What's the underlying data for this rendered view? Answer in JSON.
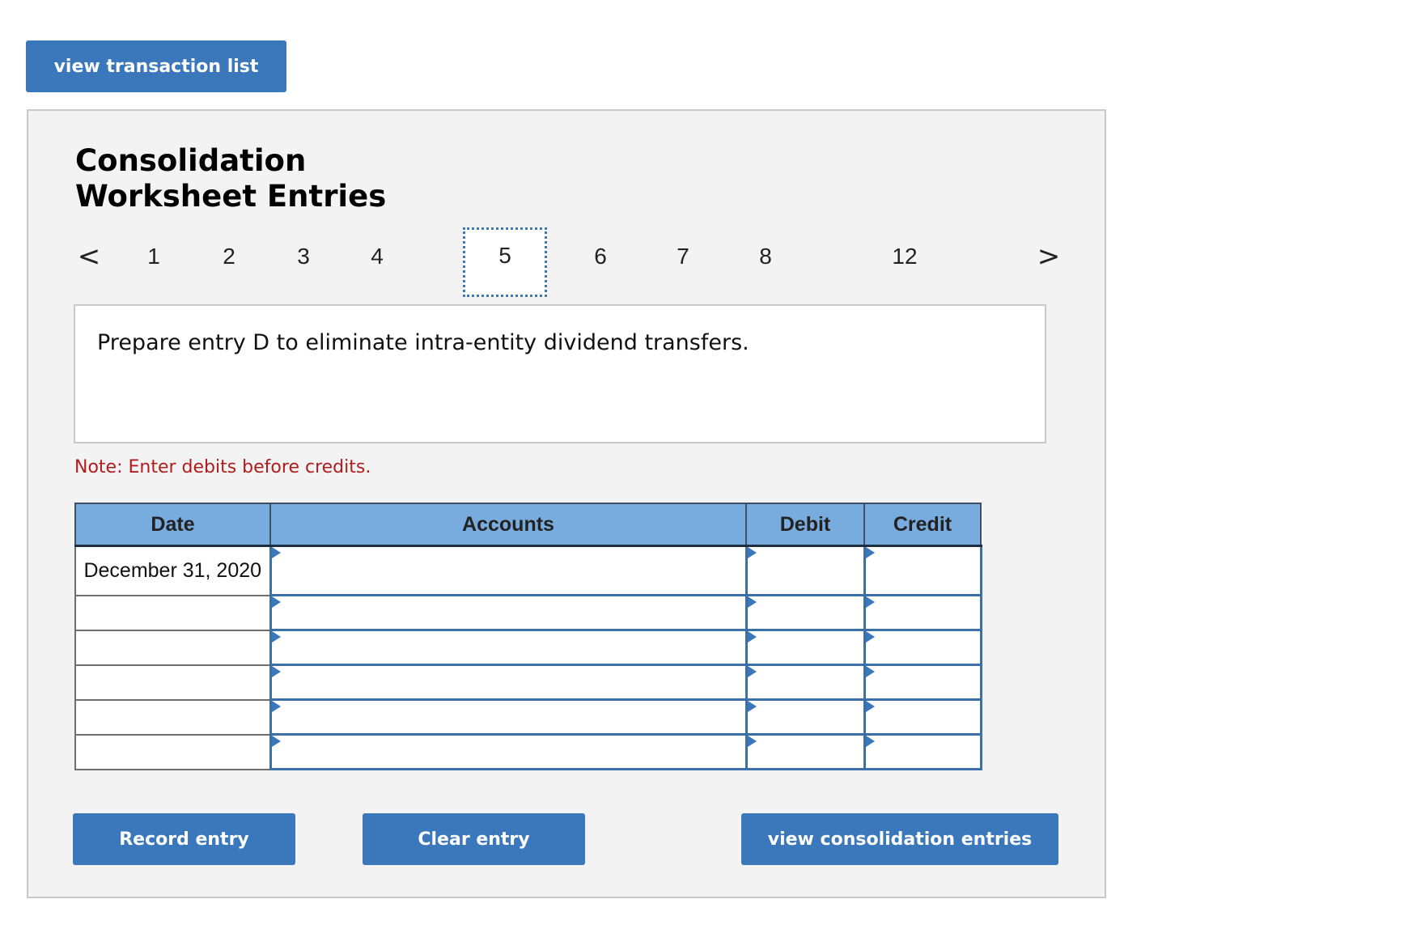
{
  "top_button": {
    "label": "view transaction list"
  },
  "panel": {
    "title_line1": "Consolidation",
    "title_line2": "Worksheet Entries",
    "pager": {
      "prev": "<",
      "next": ">",
      "pages": [
        "1",
        "2",
        "3",
        "4",
        "5",
        "6",
        "7",
        "8",
        "12"
      ],
      "active": "5"
    },
    "instruction": "Prepare entry D to eliminate intra-entity dividend transfers.",
    "note": "Note: Enter debits before credits.",
    "table": {
      "headers": [
        "Date",
        "Accounts",
        "Debit",
        "Credit"
      ],
      "rows": [
        {
          "date": "December 31, 2020",
          "account": "",
          "debit": "",
          "credit": ""
        },
        {
          "date": "",
          "account": "",
          "debit": "",
          "credit": ""
        },
        {
          "date": "",
          "account": "",
          "debit": "",
          "credit": ""
        },
        {
          "date": "",
          "account": "",
          "debit": "",
          "credit": ""
        },
        {
          "date": "",
          "account": "",
          "debit": "",
          "credit": ""
        },
        {
          "date": "",
          "account": "",
          "debit": "",
          "credit": ""
        }
      ]
    },
    "buttons": {
      "record": "Record entry",
      "clear": "Clear entry",
      "view_entries": "view consolidation entries"
    }
  },
  "colors": {
    "accent": "#3a77bb",
    "header_bg": "#78acdf",
    "note": "#b01c1c",
    "panel_bg": "#f3f3f3"
  }
}
